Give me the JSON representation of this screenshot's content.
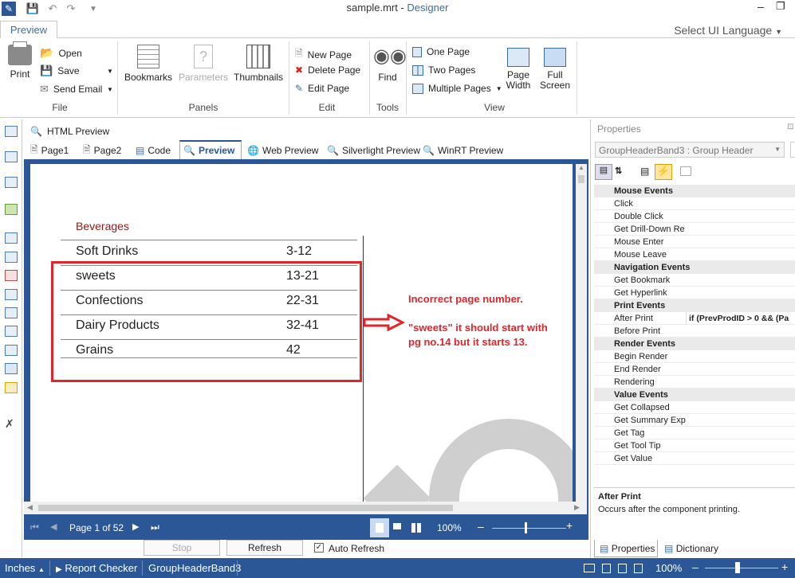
{
  "window": {
    "file": "sample.mrt",
    "separator": " - ",
    "app": "Designer"
  },
  "ribbon": {
    "active_tab": "Preview",
    "language_label": "Select UI Language",
    "file_group": {
      "label": "File",
      "print": "Print",
      "open": "Open",
      "save": "Save",
      "send_email": "Send Email"
    },
    "panels_group": {
      "label": "Panels",
      "bookmarks": "Bookmarks",
      "parameters": "Parameters",
      "thumbnails": "Thumbnails"
    },
    "edit_group": {
      "label": "Edit",
      "new_page": "New Page",
      "delete_page": "Delete Page",
      "edit_page": "Edit Page"
    },
    "tools_group": {
      "label": "Tools",
      "find": "Find"
    },
    "view_group": {
      "label": "View",
      "one_page": "One Page",
      "two_pages": "Two Pages",
      "multiple_pages": "Multiple Pages",
      "page_width": "Page Width",
      "full_screen": "Full Screen"
    }
  },
  "doc_header": {
    "html_preview": "HTML Preview"
  },
  "doc_tabs": [
    {
      "label": "Page1"
    },
    {
      "label": "Page2"
    },
    {
      "label": "Code"
    },
    {
      "label": "Preview"
    },
    {
      "label": "Web Preview"
    },
    {
      "label": "Silverlight Preview"
    },
    {
      "label": "WinRT Preview"
    }
  ],
  "report": {
    "heading": "Beverages",
    "rows": [
      {
        "name": "Soft Drinks",
        "pages": "3-12"
      },
      {
        "name": "sweets",
        "pages": "13-21"
      },
      {
        "name": "Confections",
        "pages": "22-31"
      },
      {
        "name": "Dairy Products",
        "pages": "32-41"
      },
      {
        "name": "Grains",
        "pages": "42"
      }
    ],
    "annotation_title": "Incorrect page number.",
    "annotation_line1": "\"sweets\" it should start with",
    "annotation_line2": "pg no.14 but it starts 13."
  },
  "navigation": {
    "page_text": "Page 1 of 52",
    "zoom": "100%"
  },
  "bottom_buttons": {
    "stop": "Stop",
    "refresh": "Refresh",
    "auto_refresh": "Auto Refresh"
  },
  "status": {
    "units": "Inches",
    "report_checker": "Report Checker",
    "component": "GroupHeaderBand3",
    "zoom": "100%"
  },
  "properties": {
    "title": "Properties",
    "selected": "GroupHeaderBand3 : Group Header",
    "categories": [
      {
        "name": "Mouse  Events",
        "items": [
          {
            "k": "Click",
            "v": ""
          },
          {
            "k": "Double Click",
            "v": ""
          },
          {
            "k": "Get Drill-Down Re",
            "v": ""
          },
          {
            "k": "Mouse Enter",
            "v": ""
          },
          {
            "k": "Mouse Leave",
            "v": ""
          }
        ]
      },
      {
        "name": "Navigation  Events",
        "items": [
          {
            "k": "Get Bookmark",
            "v": ""
          },
          {
            "k": "Get Hyperlink",
            "v": ""
          }
        ]
      },
      {
        "name": "Print  Events",
        "items": [
          {
            "k": "After Print",
            "v": "if (PrevProdID > 0 && (Pa"
          },
          {
            "k": "Before Print",
            "v": ""
          }
        ]
      },
      {
        "name": "Render  Events",
        "items": [
          {
            "k": "Begin Render",
            "v": ""
          },
          {
            "k": "End Render",
            "v": ""
          },
          {
            "k": "Rendering",
            "v": ""
          }
        ]
      },
      {
        "name": "Value  Events",
        "items": [
          {
            "k": "Get Collapsed",
            "v": ""
          },
          {
            "k": "Get Summary Expr",
            "v": ""
          },
          {
            "k": "Get Tag",
            "v": ""
          },
          {
            "k": "Get Tool Tip",
            "v": ""
          },
          {
            "k": "Get Value",
            "v": ""
          }
        ]
      }
    ],
    "desc_title": "After Print",
    "desc_text": "Occurs after the component printing.",
    "tab_properties": "Properties",
    "tab_dictionary": "Dictionary"
  },
  "colors": {
    "accent": "#2b5797",
    "annotation": "#e0262b"
  }
}
